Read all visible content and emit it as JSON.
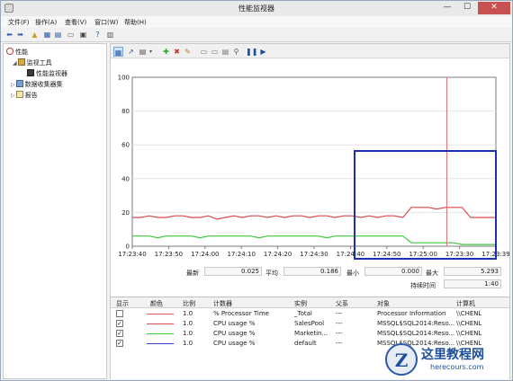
{
  "window": {
    "title": "性能监视器"
  },
  "menu": [
    "文件(F)",
    "操作(A)",
    "查看(V)",
    "窗口(W)",
    "帮助(H)"
  ],
  "tree": {
    "root": "性能",
    "monitoring_tools": "监视工具",
    "perf_monitor": "性能监视器",
    "data_collector_sets": "数据收集器集",
    "reports": "报告"
  },
  "chart_data": {
    "type": "line",
    "ylim": [
      0,
      100
    ],
    "yticks": [
      "100",
      "80",
      "60",
      "40",
      "20",
      "0"
    ],
    "xticks": [
      "17:23:40",
      "17:23:50",
      "17:24:00",
      "17:24:10",
      "17:24:20",
      "17:24:30",
      "17:24:40",
      "17:24:50",
      "17:25:00",
      "17:23:30",
      "17:23:39"
    ],
    "series": [
      {
        "color": "#d94a4a",
        "values": [
          17,
          17,
          18,
          17,
          17,
          18,
          18,
          17,
          17,
          18,
          16,
          17,
          18,
          17,
          18,
          18,
          17,
          18,
          17,
          18,
          18,
          17,
          18,
          18,
          17,
          18,
          18,
          17,
          18,
          17,
          18,
          18,
          17,
          23,
          23,
          23,
          22,
          23,
          23,
          23,
          17,
          17,
          17,
          17
        ]
      },
      {
        "color": "#3cc73c",
        "values": [
          6,
          6,
          6,
          5,
          6,
          6,
          6,
          6,
          5,
          6,
          6,
          6,
          6,
          6,
          6,
          5,
          6,
          6,
          6,
          6,
          6,
          6,
          6,
          5,
          6,
          6,
          6,
          6,
          6,
          6,
          6,
          6,
          6,
          2,
          2,
          2,
          2,
          2,
          2,
          1,
          1,
          1,
          1,
          1
        ]
      }
    ]
  },
  "stats": {
    "last_label": "最新",
    "last_value": "0.025",
    "avg_label": "平均",
    "avg_value": "0.186",
    "min_label": "最小",
    "min_value": "0.000",
    "max_label": "最大",
    "max_value": "5.293",
    "duration_label": "持续时间",
    "duration_value": "1:40"
  },
  "table": {
    "headers": {
      "show": "显示",
      "color": "颜色",
      "scale": "比例",
      "counter": "计数器",
      "instance": "实例",
      "parent": "父系",
      "object": "对象",
      "computer": "计算机"
    },
    "rows": [
      {
        "checked": false,
        "color": "#e05a5a",
        "scale": "1.0",
        "counter": "% Processor Time",
        "instance": "_Total",
        "parent": "---",
        "object": "Processor Information",
        "computer": "\\\\CHENL"
      },
      {
        "checked": true,
        "color": "#d94a4a",
        "scale": "1.0",
        "counter": "CPU usage %",
        "instance": "SalesPool",
        "parent": "---",
        "object": "MSSQL$SQL2014:Reso...",
        "computer": "\\\\CHENL"
      },
      {
        "checked": true,
        "color": "#3cc73c",
        "scale": "1.0",
        "counter": "CPU usage %",
        "instance": "Marketin...",
        "parent": "---",
        "object": "MSSQL$SQL2014:Reso...",
        "computer": "\\\\CHENL"
      },
      {
        "checked": true,
        "color": "#2b3fc8",
        "scale": "1.0",
        "counter": "CPU usage %",
        "instance": "default",
        "parent": "---",
        "object": "MSSQL$SQL2014:Reso...",
        "computer": "\\\\CHENL"
      }
    ]
  },
  "watermark": {
    "logo_letter": "Z",
    "title": "这里教程网",
    "url": "herecours.com"
  },
  "colors": {
    "highlight_box": "#1d2fb3",
    "cursor_line": "#e07070"
  }
}
